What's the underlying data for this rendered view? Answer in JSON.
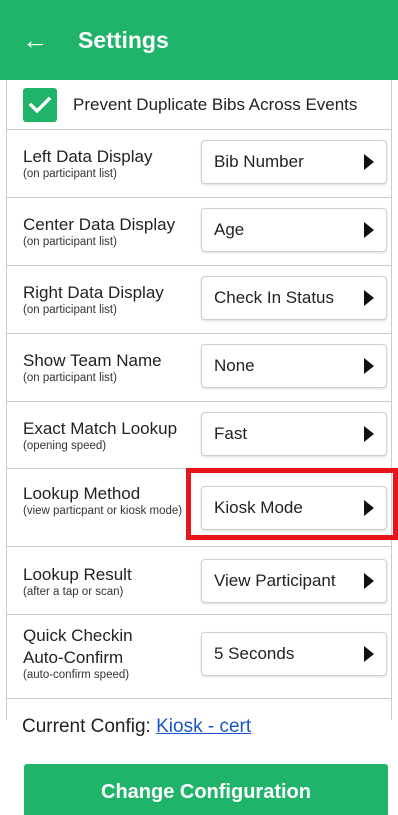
{
  "header": {
    "back_icon": "arrow-left-icon",
    "title": "Settings"
  },
  "duplicate_bibs": {
    "checked": true,
    "label": "Prevent Duplicate Bibs Across Events"
  },
  "settings": [
    {
      "label": "Left Data Display",
      "sublabel": "(on participant list)",
      "value": "Bib Number"
    },
    {
      "label": "Center Data Display",
      "sublabel": "(on participant list)",
      "value": "Age"
    },
    {
      "label": "Right Data Display",
      "sublabel": "(on participant list)",
      "value": "Check In Status"
    },
    {
      "label": "Show Team Name",
      "sublabel": "(on participant list)",
      "value": "None"
    },
    {
      "label": "Exact Match Lookup",
      "sublabel": "(opening speed)",
      "value": "Fast"
    },
    {
      "label": "Lookup Method",
      "sublabel": "(view particpant or kiosk mode)",
      "value": "Kiosk Mode"
    },
    {
      "label": "Lookup Result",
      "sublabel": "(after a tap or scan)",
      "value": "View Participant"
    },
    {
      "label": "Quick Checkin Auto-Confirm",
      "sublabel": "(auto-confirm speed)",
      "value": "5 Seconds"
    }
  ],
  "current_config": {
    "label": "Current Config:",
    "link": "Kiosk - cert"
  },
  "change_button": "Change Configuration",
  "colors": {
    "accent": "#1fb46a",
    "highlight": "#e8141b",
    "link": "#1a56c4"
  }
}
